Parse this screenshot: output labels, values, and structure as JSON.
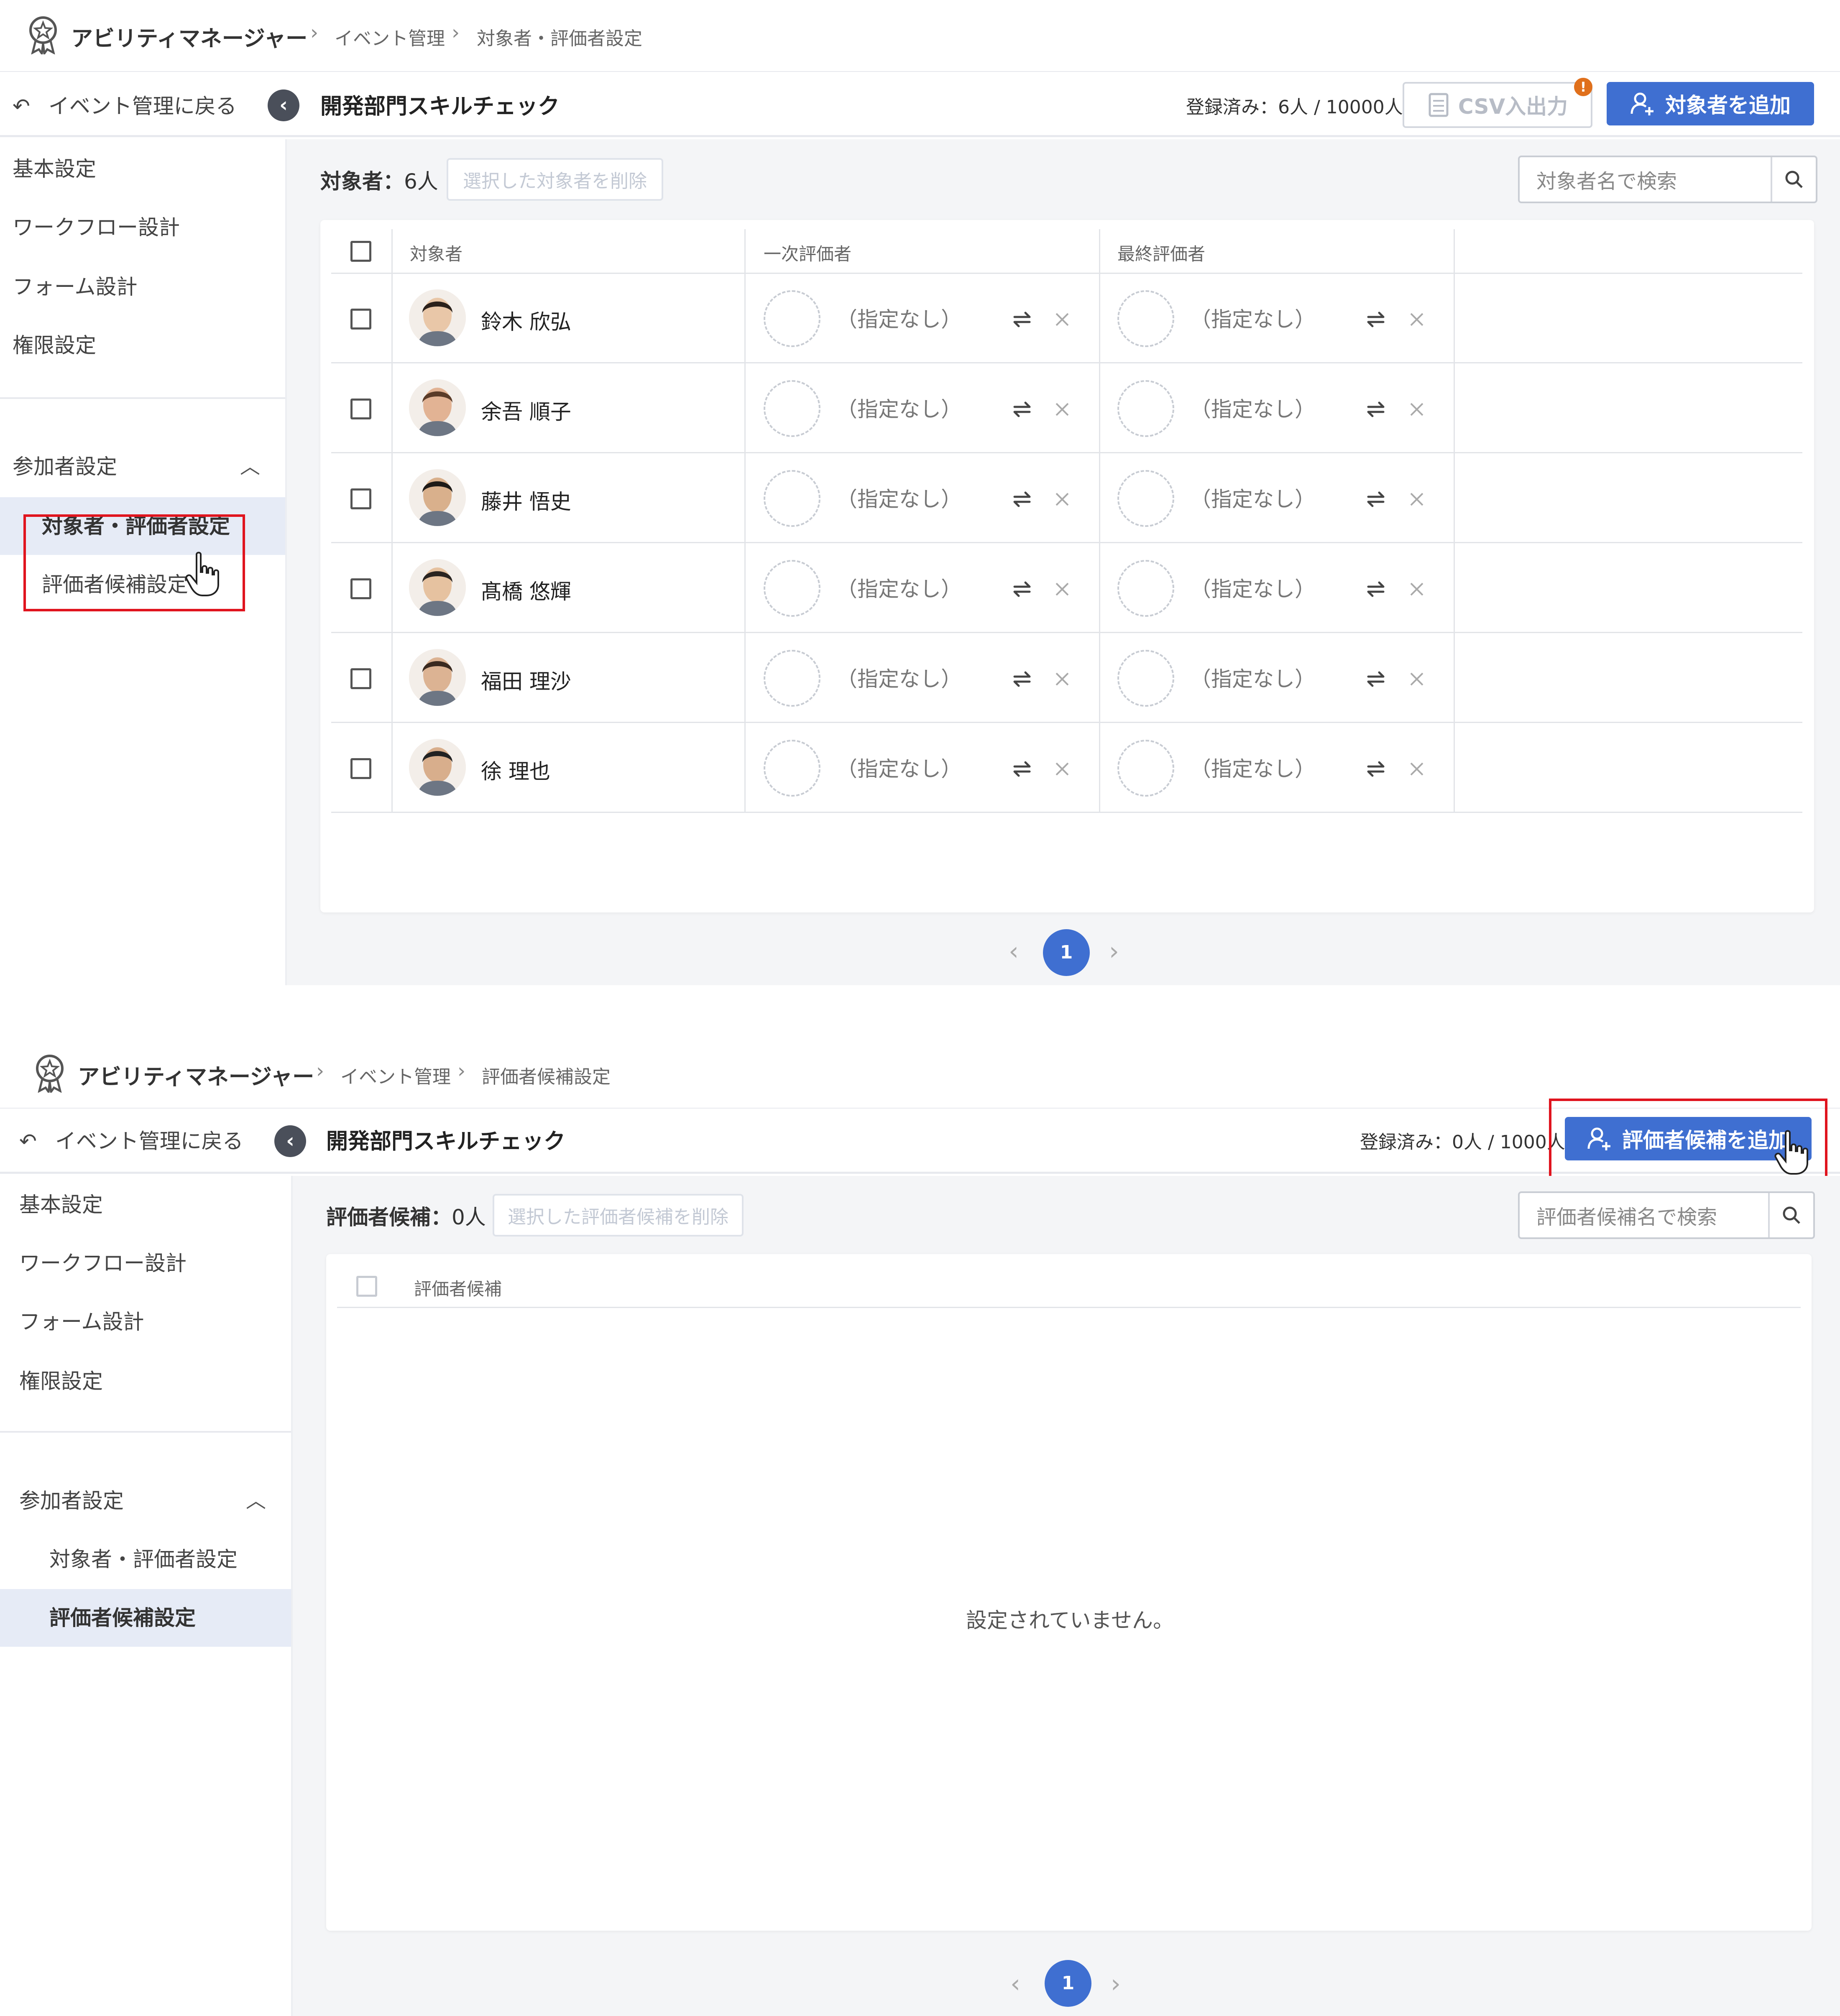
{
  "screen1": {
    "breadcrumb": {
      "app": "アビリティマネージャー",
      "items": [
        "イベント管理",
        "対象者・評価者設定"
      ]
    },
    "back_label": "イベント管理に戻る",
    "title": "開発部門スキルチェック",
    "registered": "登録済み：6人 / 10000人",
    "csv_label": "CSV入出力",
    "csv_badge": "!",
    "add_button": "対象者を追加",
    "sidebar": {
      "items": [
        "基本設定",
        "ワークフロー設計",
        "フォーム設計",
        "権限設定"
      ],
      "group": "参加者設定",
      "sub_items": [
        "対象者・評価者設定",
        "評価者候補設定"
      ]
    },
    "count_label": "対象者：",
    "count_value": "6人",
    "delete_selected": "選択した対象者を削除",
    "search_placeholder": "対象者名で検索",
    "columns": [
      "対象者",
      "一次評価者",
      "最終評価者"
    ],
    "rows": [
      {
        "name": "鈴木 欣弘",
        "first": "（指定なし）",
        "final": "（指定なし）"
      },
      {
        "name": "余吾 順子",
        "first": "（指定なし）",
        "final": "（指定なし）"
      },
      {
        "name": "藤井 悟史",
        "first": "（指定なし）",
        "final": "（指定なし）"
      },
      {
        "name": "髙橋 悠輝",
        "first": "（指定なし）",
        "final": "（指定なし）"
      },
      {
        "name": "福田 理沙",
        "first": "（指定なし）",
        "final": "（指定なし）"
      },
      {
        "name": "徐 理也",
        "first": "（指定なし）",
        "final": "（指定なし）"
      }
    ],
    "page": "1"
  },
  "screen2": {
    "breadcrumb": {
      "app": "アビリティマネージャー",
      "items": [
        "イベント管理",
        "評価者候補設定"
      ]
    },
    "back_label": "イベント管理に戻る",
    "title": "開発部門スキルチェック",
    "registered": "登録済み：0人 / 1000人",
    "add_button": "評価者候補を追加",
    "sidebar": {
      "items": [
        "基本設定",
        "ワークフロー設計",
        "フォーム設計",
        "権限設定"
      ],
      "group": "参加者設定",
      "sub_items": [
        "対象者・評価者設定",
        "評価者候補設定"
      ]
    },
    "count_label": "評価者候補：",
    "count_value": "0人",
    "delete_selected": "選択した評価者候補を削除",
    "search_placeholder": "評価者候補名で検索",
    "column": "評価者候補",
    "empty_message": "設定されていません。",
    "page": "1"
  },
  "colors": {
    "primary": "#3f6fd1",
    "highlight": "#e0141e",
    "active_bg": "#e6ebf6",
    "badge": "#e0701c"
  }
}
